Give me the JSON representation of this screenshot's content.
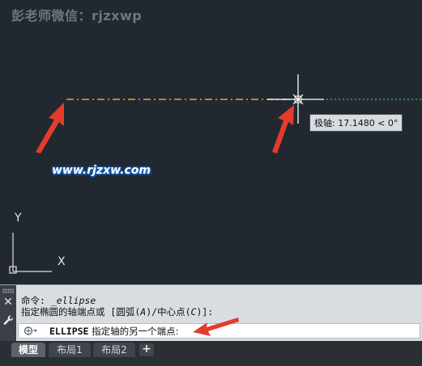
{
  "watermark": {
    "top_text": "彭老师微信：rjzxwp",
    "url_text": "www.rjzxw.com"
  },
  "tooltip": {
    "text": "极轴: 17.1480 < 0°"
  },
  "ucs": {
    "x_label": "X",
    "y_label": "Y"
  },
  "command_line": {
    "history_line1_prefix": "命令: ",
    "history_line1_cmd": "_ellipse",
    "history_line2_prefix": "指定椭圆的轴端点或 [圆弧(",
    "history_line2_opt1": "A",
    "history_line2_mid": ")/中心点(",
    "history_line2_opt2": "C",
    "history_line2_suffix": ")]:",
    "prompt_cmd": "ELLIPSE",
    "prompt_text": " 指定轴的另一个端点:"
  },
  "tabs": [
    {
      "label": "模型",
      "active": true
    },
    {
      "label": "布局1",
      "active": false
    },
    {
      "label": "布局2",
      "active": false
    }
  ],
  "tab_add_label": "+",
  "colors": {
    "canvas_bg": "#212830",
    "axis_dash_orange": "#e8a33c",
    "polar_track_green": "#2ecc40",
    "arrow_red": "#e53b2c"
  },
  "icons": {
    "close": "close-icon",
    "wrench": "wrench-icon",
    "dropdown": "command-dropdown-icon",
    "crosshair": "crosshair-cursor-icon",
    "ucs": "ucs-axis-icon",
    "arrow": "red-arrow-icon"
  }
}
